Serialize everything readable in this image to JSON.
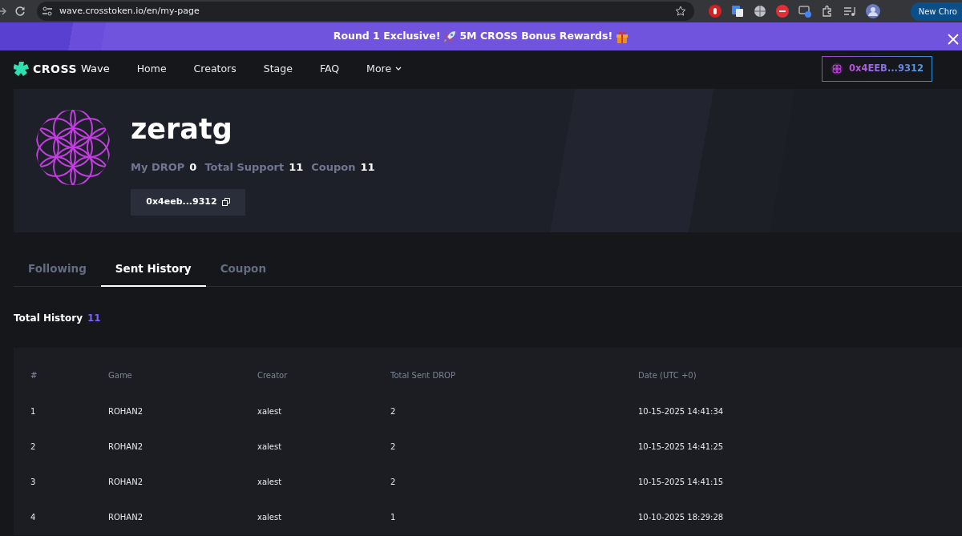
{
  "browser": {
    "url": "wave.crosstoken.io/en/my-page",
    "profile_button": "New Chro"
  },
  "banner": {
    "parts": [
      {
        "kind": "text",
        "text": "Round 1 Exclusive!"
      },
      {
        "kind": "rocket"
      },
      {
        "kind": "text",
        "text": "5M CROSS Bonus Rewards!"
      },
      {
        "kind": "gift"
      }
    ]
  },
  "navbar": {
    "logo": {
      "brand": "CROSS",
      "product": "Wave"
    },
    "links": [
      {
        "label": "Home",
        "dropdown": false
      },
      {
        "label": "Creators",
        "dropdown": false
      },
      {
        "label": "Stage",
        "dropdown": false
      },
      {
        "label": "FAQ",
        "dropdown": false
      },
      {
        "label": "More",
        "dropdown": true
      }
    ],
    "wallet": "0x4EEB...9312"
  },
  "profile": {
    "name": "zeratg",
    "stats": [
      {
        "label": "My DROP",
        "value": "0"
      },
      {
        "label": "Total Support",
        "value": "11"
      },
      {
        "label": "Coupon",
        "value": "11"
      }
    ],
    "address": "0x4eeb...9312"
  },
  "tabs": [
    {
      "label": "Following",
      "selected": false
    },
    {
      "label": "Sent History",
      "selected": true
    },
    {
      "label": "Coupon",
      "selected": false
    }
  ],
  "summary": {
    "label": "Total History",
    "value": "11"
  },
  "table": {
    "columns": [
      "#",
      "Game",
      "Creator",
      "Total Sent DROP",
      "Date (UTC +0)"
    ],
    "rows": [
      [
        "1",
        "ROHAN2",
        "xalest",
        "2",
        "10-15-2025 14:41:34"
      ],
      [
        "2",
        "ROHAN2",
        "xalest",
        "2",
        "10-15-2025 14:41:25"
      ],
      [
        "3",
        "ROHAN2",
        "xalest",
        "2",
        "10-15-2025 14:41:15"
      ],
      [
        "4",
        "ROHAN2",
        "xalest",
        "1",
        "10-10-2025 18:29:28"
      ]
    ]
  }
}
